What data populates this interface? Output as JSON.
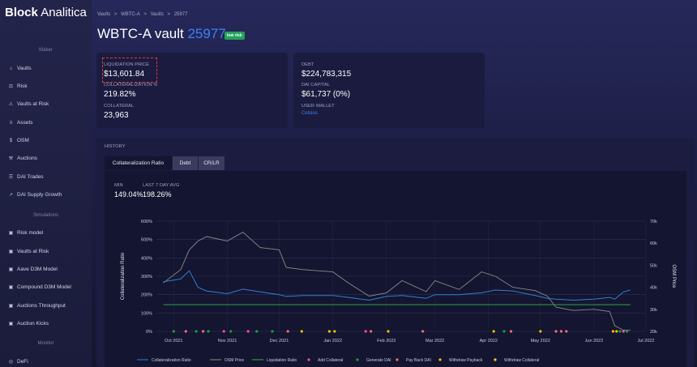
{
  "brand": {
    "bold": "Block",
    "light": " Analitica"
  },
  "sidebar": {
    "sections": {
      "maker": "Maker",
      "simulations": "Simulations",
      "monitor": "Monitor"
    },
    "items": [
      {
        "label": "Vaults",
        "icon": "bank-icon"
      },
      {
        "label": "Risk",
        "icon": "scale-icon"
      },
      {
        "label": "Vaults at Risk",
        "icon": "warning-icon"
      },
      {
        "label": "Assets",
        "icon": "stack-icon"
      },
      {
        "label": "OSM",
        "icon": "dollar-icon"
      },
      {
        "label": "Auctions",
        "icon": "gavel-icon"
      },
      {
        "label": "DAI Trades",
        "icon": "chart-icon"
      },
      {
        "label": "DAI Supply Growth",
        "icon": "growth-icon"
      },
      {
        "label": "Risk model",
        "icon": "model-icon"
      },
      {
        "label": "Vaults at Risk",
        "icon": "model-icon"
      },
      {
        "label": "Aave D3M Model",
        "icon": "model-icon"
      },
      {
        "label": "Compound D3M Model",
        "icon": "model-icon"
      },
      {
        "label": "Auctions Throughput",
        "icon": "model-icon"
      },
      {
        "label": "Auction Kicks",
        "icon": "model-icon"
      },
      {
        "label": "DeFi",
        "icon": "globe-icon"
      }
    ]
  },
  "breadcrumb": [
    "Vaults",
    ">",
    "WBTC-A",
    ">",
    "Vaults",
    ">",
    "25977"
  ],
  "title": {
    "prefix": "WBTC-A vault ",
    "id": "25977",
    "badge": "low risk"
  },
  "stats": {
    "liq_price_label": "LIQUIDATION PRICE",
    "liq_price": "$13,601.84",
    "coll_ratio_label": "COLLATERALIZATION %",
    "coll_ratio": "219.82%",
    "collateral_label": "COLLATERAL",
    "collateral": "23,963",
    "debt_label": "DEBT",
    "debt": "$224,783,315",
    "dai_capital_label": "DAI CAPITAL",
    "dai_capital": "$61,737 (0%)",
    "wallet_label": "USER WALLET",
    "wallet": "Celsius"
  },
  "history": {
    "label": "HISTORY",
    "tabs": [
      "Collateralization Ratio",
      "Debt",
      "CR/LR"
    ],
    "min_label": "MIN",
    "min": "149.04%",
    "avg_label": "LAST 7 DAY AVG",
    "avg": "198.26%"
  },
  "colors": {
    "ratio": "#2f80d0",
    "osm": "#8a8a8a",
    "liq": "#2fb84a",
    "add": "#ff4da6",
    "generate": "#1f9e3a",
    "payback": "#ff6b7d",
    "withdraw_payback": "#f2c200",
    "withdraw": "#f5d033"
  },
  "chart_data": {
    "type": "line",
    "xlabel": "",
    "ylabel": "Collateralization Ratio",
    "y2label": "OSM Price",
    "x_ticks": [
      "Oct 2021",
      "Nov 2021",
      "Dec 2021",
      "Jan 2022",
      "Feb 2022",
      "Mar 2022",
      "Apr 2022",
      "May 2022",
      "Jun 2022",
      "Jul 2022"
    ],
    "y_ticks": [
      "0%",
      "100%",
      "200%",
      "300%",
      "400%",
      "500%",
      "600%"
    ],
    "y2_ticks": [
      "20k",
      "30k",
      "40k",
      "50k",
      "60k",
      "70k"
    ],
    "ylim": [
      0,
      600
    ],
    "y2lim": [
      20000,
      70000
    ],
    "x_dates": [
      "2021-09-25",
      "2021-10-05",
      "2021-10-10",
      "2021-10-15",
      "2021-10-20",
      "2021-11-01",
      "2021-11-10",
      "2021-11-20",
      "2021-12-01",
      "2021-12-05",
      "2021-12-15",
      "2022-01-01",
      "2022-01-10",
      "2022-01-22",
      "2022-02-01",
      "2022-02-10",
      "2022-02-24",
      "2022-03-01",
      "2022-03-15",
      "2022-03-28",
      "2022-04-05",
      "2022-04-15",
      "2022-04-28",
      "2022-05-05",
      "2022-05-10",
      "2022-05-20",
      "2022-06-01",
      "2022-06-10",
      "2022-06-13",
      "2022-06-18",
      "2022-06-22"
    ],
    "series": [
      {
        "name": "Collateralization Ratio",
        "values": [
          270,
          285,
          330,
          240,
          220,
          205,
          230,
          215,
          200,
          190,
          195,
          195,
          185,
          170,
          190,
          195,
          180,
          200,
          200,
          210,
          225,
          220,
          195,
          180,
          175,
          170,
          175,
          185,
          175,
          215,
          225
        ]
      },
      {
        "name": "OSM Price",
        "values": [
          42000,
          48000,
          57000,
          61000,
          63000,
          61000,
          65000,
          58000,
          57000,
          49000,
          48000,
          47000,
          42000,
          36000,
          37500,
          43000,
          38000,
          43000,
          39000,
          47000,
          45000,
          40000,
          38500,
          36000,
          31000,
          29500,
          30000,
          29000,
          22500,
          20500,
          20500
        ]
      },
      {
        "name": "Liquidation Ratio",
        "values": [
          145,
          145,
          145,
          145,
          145,
          145,
          145,
          145,
          145,
          145,
          145,
          145,
          145,
          145,
          145,
          145,
          145,
          145,
          145,
          145,
          145,
          145,
          145,
          145,
          145,
          145,
          145,
          145,
          145,
          145,
          145
        ]
      }
    ],
    "legend": [
      "Collateralization Ratio",
      "OSM Price",
      "Liquidation Ratio",
      "Add Collateral",
      "Generate DAI",
      "Pay Back DAI",
      "Withdraw Payback",
      "Withdraw Collateral"
    ],
    "legend_position": "bottom",
    "events": [
      {
        "date": "2021-10-01",
        "type": "Generate DAI"
      },
      {
        "date": "2021-10-08",
        "type": "Pay Back DAI"
      },
      {
        "date": "2021-10-14",
        "type": "Generate DAI"
      },
      {
        "date": "2021-10-18",
        "type": "Pay Back DAI"
      },
      {
        "date": "2021-10-21",
        "type": "Generate DAI"
      },
      {
        "date": "2021-10-30",
        "type": "Add Collateral"
      },
      {
        "date": "2021-11-03",
        "type": "Generate DAI"
      },
      {
        "date": "2021-11-13",
        "type": "Add Collateral"
      },
      {
        "date": "2021-11-18",
        "type": "Generate DAI"
      },
      {
        "date": "2021-11-27",
        "type": "Generate DAI"
      },
      {
        "date": "2021-12-06",
        "type": "Pay Back DAI"
      },
      {
        "date": "2021-12-14",
        "type": "Withdraw Payback"
      },
      {
        "date": "2021-12-30",
        "type": "Withdraw Payback"
      },
      {
        "date": "2022-01-02",
        "type": "Withdraw Payback"
      },
      {
        "date": "2022-01-20",
        "type": "Add Collateral"
      },
      {
        "date": "2022-01-23",
        "type": "Pay Back DAI"
      },
      {
        "date": "2022-02-02",
        "type": "Withdraw Payback"
      },
      {
        "date": "2022-02-22",
        "type": "Pay Back DAI"
      },
      {
        "date": "2022-04-04",
        "type": "Withdraw Payback"
      },
      {
        "date": "2022-04-10",
        "type": "Generate DAI"
      },
      {
        "date": "2022-04-14",
        "type": "Pay Back DAI"
      },
      {
        "date": "2022-05-01",
        "type": "Withdraw Payback"
      },
      {
        "date": "2022-05-10",
        "type": "Pay Back DAI"
      },
      {
        "date": "2022-05-13",
        "type": "Pay Back DAI"
      },
      {
        "date": "2022-05-16",
        "type": "Pay Back DAI"
      },
      {
        "date": "2022-06-12",
        "type": "Withdraw Payback"
      },
      {
        "date": "2022-06-14",
        "type": "Withdraw Payback"
      },
      {
        "date": "2022-06-16",
        "type": "Generate DAI"
      },
      {
        "date": "2022-06-18",
        "type": "Add Collateral"
      },
      {
        "date": "2022-06-20",
        "type": "Generate DAI"
      }
    ]
  }
}
